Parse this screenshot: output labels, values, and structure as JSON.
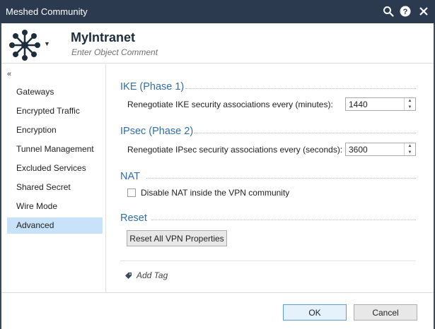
{
  "window": {
    "title": "Meshed Community",
    "icons": [
      "search-icon",
      "help-icon",
      "close-icon"
    ]
  },
  "header": {
    "object_name": "MyIntranet",
    "comment_placeholder": "Enter Object Comment",
    "logo_icon": "mesh-community-icon"
  },
  "sidebar": {
    "collapse_icon": "double-chevron-left-icon",
    "items": [
      {
        "label": "Gateways",
        "active": false
      },
      {
        "label": "Encrypted Traffic",
        "active": false
      },
      {
        "label": "Encryption",
        "active": false
      },
      {
        "label": "Tunnel Management",
        "active": false
      },
      {
        "label": "Excluded Services",
        "active": false
      },
      {
        "label": "Shared Secret",
        "active": false
      },
      {
        "label": "Wire Mode",
        "active": false
      },
      {
        "label": "Advanced",
        "active": true
      }
    ]
  },
  "sections": {
    "ike": {
      "title": "IKE (Phase 1)",
      "label": "Renegotiate IKE security associations every (minutes):",
      "value": "1440"
    },
    "ipsec": {
      "title": "IPsec (Phase 2)",
      "label": "Renegotiate IPsec security associations every (seconds):",
      "value": "3600"
    },
    "nat": {
      "title": "NAT",
      "checkbox_label": "Disable NAT inside the VPN community",
      "checked": false
    },
    "reset": {
      "title": "Reset",
      "button_label": "Reset All VPN Properties"
    }
  },
  "tag": {
    "label": "Add Tag",
    "icon": "tag-icon"
  },
  "footer": {
    "ok_label": "OK",
    "cancel_label": "Cancel"
  },
  "colors": {
    "titlebar": "#2b3a4e",
    "section_title": "#2f6ea8",
    "active_nav": "#c8e3f9",
    "ok_border": "#5d9bd3"
  }
}
